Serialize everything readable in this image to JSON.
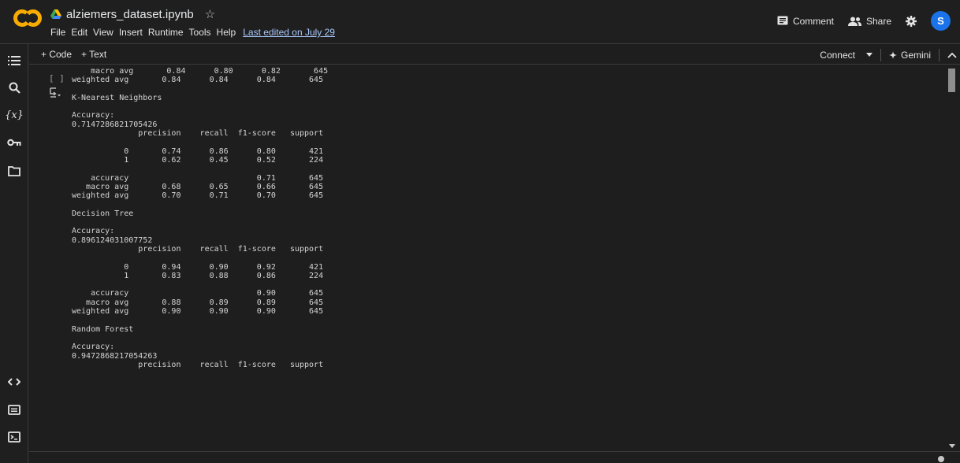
{
  "header": {
    "notebook_title": "alziemers_dataset.ipynb",
    "menu": [
      "File",
      "Edit",
      "View",
      "Insert",
      "Runtime",
      "Tools",
      "Help"
    ],
    "last_edited": "Last edited on July 29",
    "comment_label": "Comment",
    "share_label": "Share",
    "avatar_letter": "S"
  },
  "toolbar": {
    "add_code": "+ Code",
    "add_text": "+ Text",
    "connect": "Connect",
    "gemini": "Gemini"
  },
  "cell": {
    "run_indicator": "[ ]",
    "output": "    macro avg       0.84      0.80      0.82       645\nweighted avg       0.84      0.84      0.84       645\n\nK-Nearest Neighbors\n\nAccuracy:\n0.7147286821705426\n              precision    recall  f1-score   support\n\n           0       0.74      0.86      0.80       421\n           1       0.62      0.45      0.52       224\n\n    accuracy                           0.71       645\n   macro avg       0.68      0.65      0.66       645\nweighted avg       0.70      0.71      0.70       645\n\nDecision Tree\n\nAccuracy:\n0.896124031007752\n              precision    recall  f1-score   support\n\n           0       0.94      0.90      0.92       421\n           1       0.83      0.88      0.86       224\n\n    accuracy                           0.90       645\n   macro avg       0.88      0.89      0.89       645\nweighted avg       0.90      0.90      0.90       645\n\nRandom Forest\n\nAccuracy:\n0.9472868217054263\n              precision    recall  f1-score   support"
  },
  "sidebar_icons": [
    "table-of-contents-icon",
    "search-icon",
    "variables-icon",
    "secrets-key-icon",
    "files-folder-icon",
    "code-snippets-icon",
    "command-palette-icon",
    "terminal-icon"
  ],
  "colors": {
    "background": "#1e1e1e",
    "logo_orange": "#f9ab00",
    "link_blue": "#a8c7fa",
    "avatar_blue": "#1a73e8"
  }
}
